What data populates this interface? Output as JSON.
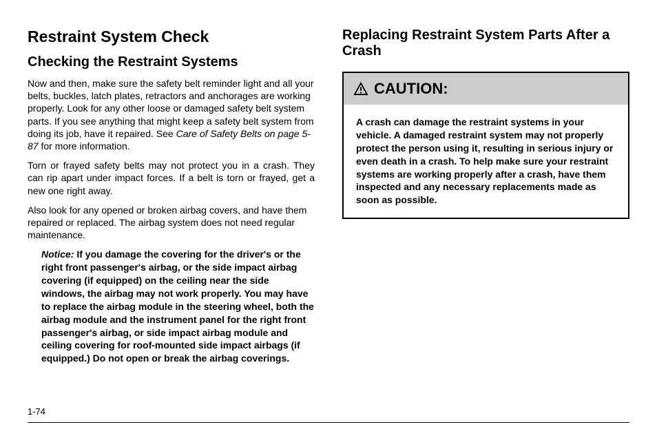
{
  "left_column": {
    "main_heading": "Restraint System Check",
    "sub_heading": "Checking the Restraint Systems",
    "para1_part1": "Now and then, make sure the safety belt reminder light and all your belts, buckles, latch plates, retractors and anchorages are working properly. Look for any other loose or damaged safety belt system parts. If you see anything that might keep a safety belt system from doing its job, have it repaired. See ",
    "para1_ref": "Care of Safety Belts on page 5-87",
    "para1_part2": " for more information.",
    "para2": "Torn or frayed safety belts may not protect you in a crash. They can rip apart under impact forces. If a belt is torn or frayed, get a new one right away.",
    "para3": "Also look for any opened or broken airbag covers, and have them repaired or replaced. The airbag system does not need regular maintenance.",
    "notice_label": "Notice:",
    "notice_text": "If you damage the covering for the driver's or the right front passenger's airbag, or the side impact airbag covering (if equipped) on the ceiling near the side windows, the airbag may not work properly. You may have to replace the airbag module in the steering wheel, both the airbag module and the instrument panel for the right front passenger's airbag, or side impact airbag module and ceiling covering for roof-mounted side impact airbags (if equipped.) Do not open or break the airbag coverings."
  },
  "right_column": {
    "sub_heading": "Replacing Restraint System Parts After a Crash",
    "caution_label": "CAUTION:",
    "caution_body": "A crash can damage the restraint systems in your vehicle. A damaged restraint system may not properly protect the person using it, resulting in serious injury or even death in a crash. To help make sure your restraint systems are working properly after a crash, have them inspected and any necessary replacements made as soon as possible."
  },
  "footer": {
    "page_number": "1-74"
  }
}
